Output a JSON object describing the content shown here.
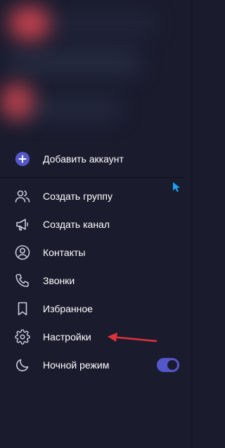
{
  "menu": {
    "add_account": "Добавить аккаунт",
    "create_group": "Создать группу",
    "create_channel": "Создать канал",
    "contacts": "Контакты",
    "calls": "Звонки",
    "saved": "Избранное",
    "settings": "Настройки",
    "night_mode": "Ночной режим"
  },
  "toggles": {
    "night_mode_on": true
  },
  "colors": {
    "background": "#1a1c2e",
    "accent": "#5457c9",
    "annotation_arrow": "#e0323a",
    "text": "#ffffff",
    "icon": "#c8cad8"
  },
  "icons": {
    "add_account": "plus-circle-icon",
    "create_group": "people-icon",
    "create_channel": "megaphone-icon",
    "contacts": "person-circle-icon",
    "calls": "phone-icon",
    "saved": "bookmark-icon",
    "settings": "gear-icon",
    "night_mode": "moon-icon"
  }
}
